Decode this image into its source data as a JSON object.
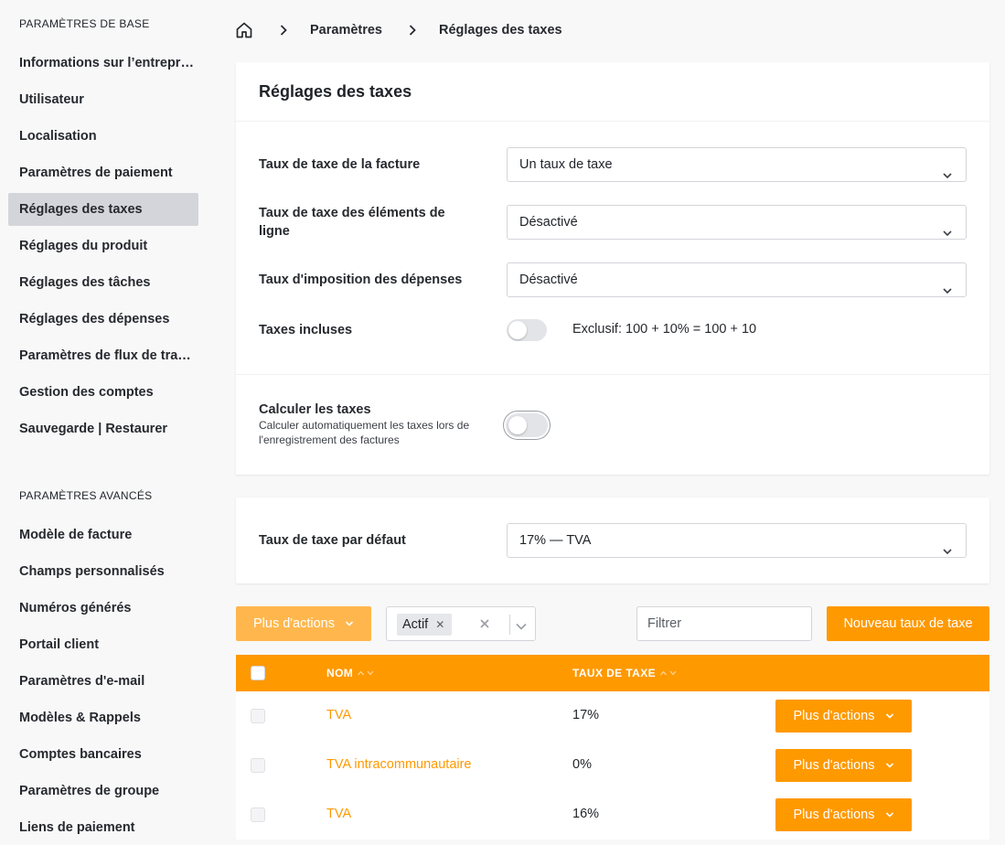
{
  "sidebar": {
    "basic_heading": "PARAMÈTRES DE BASE",
    "basic_items": [
      "Informations sur l’entrepr…",
      "Utilisateur",
      "Localisation",
      "Paramètres de paiement",
      "Réglages des taxes",
      "Réglages du produit",
      "Réglages des tâches",
      "Réglages des dépenses",
      "Paramètres de flux de tra…",
      "Gestion des comptes",
      "Sauvegarde | Restaurer"
    ],
    "advanced_heading": "PARAMÈTRES AVANCÉS",
    "advanced_items": [
      "Modèle de facture",
      "Champs personnalisés",
      "Numéros générés",
      "Portail client",
      "Paramètres d'e-mail",
      "Modèles & Rappels",
      "Comptes bancaires",
      "Paramètres de groupe",
      "Liens de paiement"
    ]
  },
  "breadcrumb": {
    "home_icon": "home-icon",
    "items": [
      "Paramètres",
      "Réglages des taxes"
    ]
  },
  "tax_settings": {
    "title": "Réglages des taxes",
    "invoice_tax_label": "Taux de taxe de la facture",
    "invoice_tax_value": "Un taux de taxe",
    "line_item_tax_label": "Taux de taxe des éléments de ligne",
    "line_item_tax_value": "Désactivé",
    "expense_tax_label": "Taux d'imposition des dépenses",
    "expense_tax_value": "Désactivé",
    "inclusive_label": "Taxes incluses",
    "inclusive_hint": "Exclusif: 100 + 10% = 100 + 10",
    "calc_label": "Calculer les taxes",
    "calc_help": "Calculer automatiquement les taxes lors de l'enregistrement des factures"
  },
  "default_tax": {
    "label": "Taux de taxe par défaut",
    "value": "17% — TVA"
  },
  "toolbar": {
    "more_actions": "Plus d'actions",
    "status_chip": "Actif",
    "filter_placeholder": "Filtrer",
    "new_button": "Nouveau taux de taxe"
  },
  "table": {
    "columns": [
      "NOM",
      "TAUX DE TAXE"
    ],
    "rows": [
      {
        "name": "TVA",
        "rate": "17%",
        "action": "Plus d'actions"
      },
      {
        "name": "TVA intracommunautaire",
        "rate": "0%",
        "action": "Plus d'actions"
      },
      {
        "name": "TVA",
        "rate": "16%",
        "action": "Plus d'actions"
      }
    ]
  },
  "colors": {
    "accent": "#ff9900",
    "accent_light": "#ffb74d",
    "sidebar_active": "#d4d5da"
  }
}
